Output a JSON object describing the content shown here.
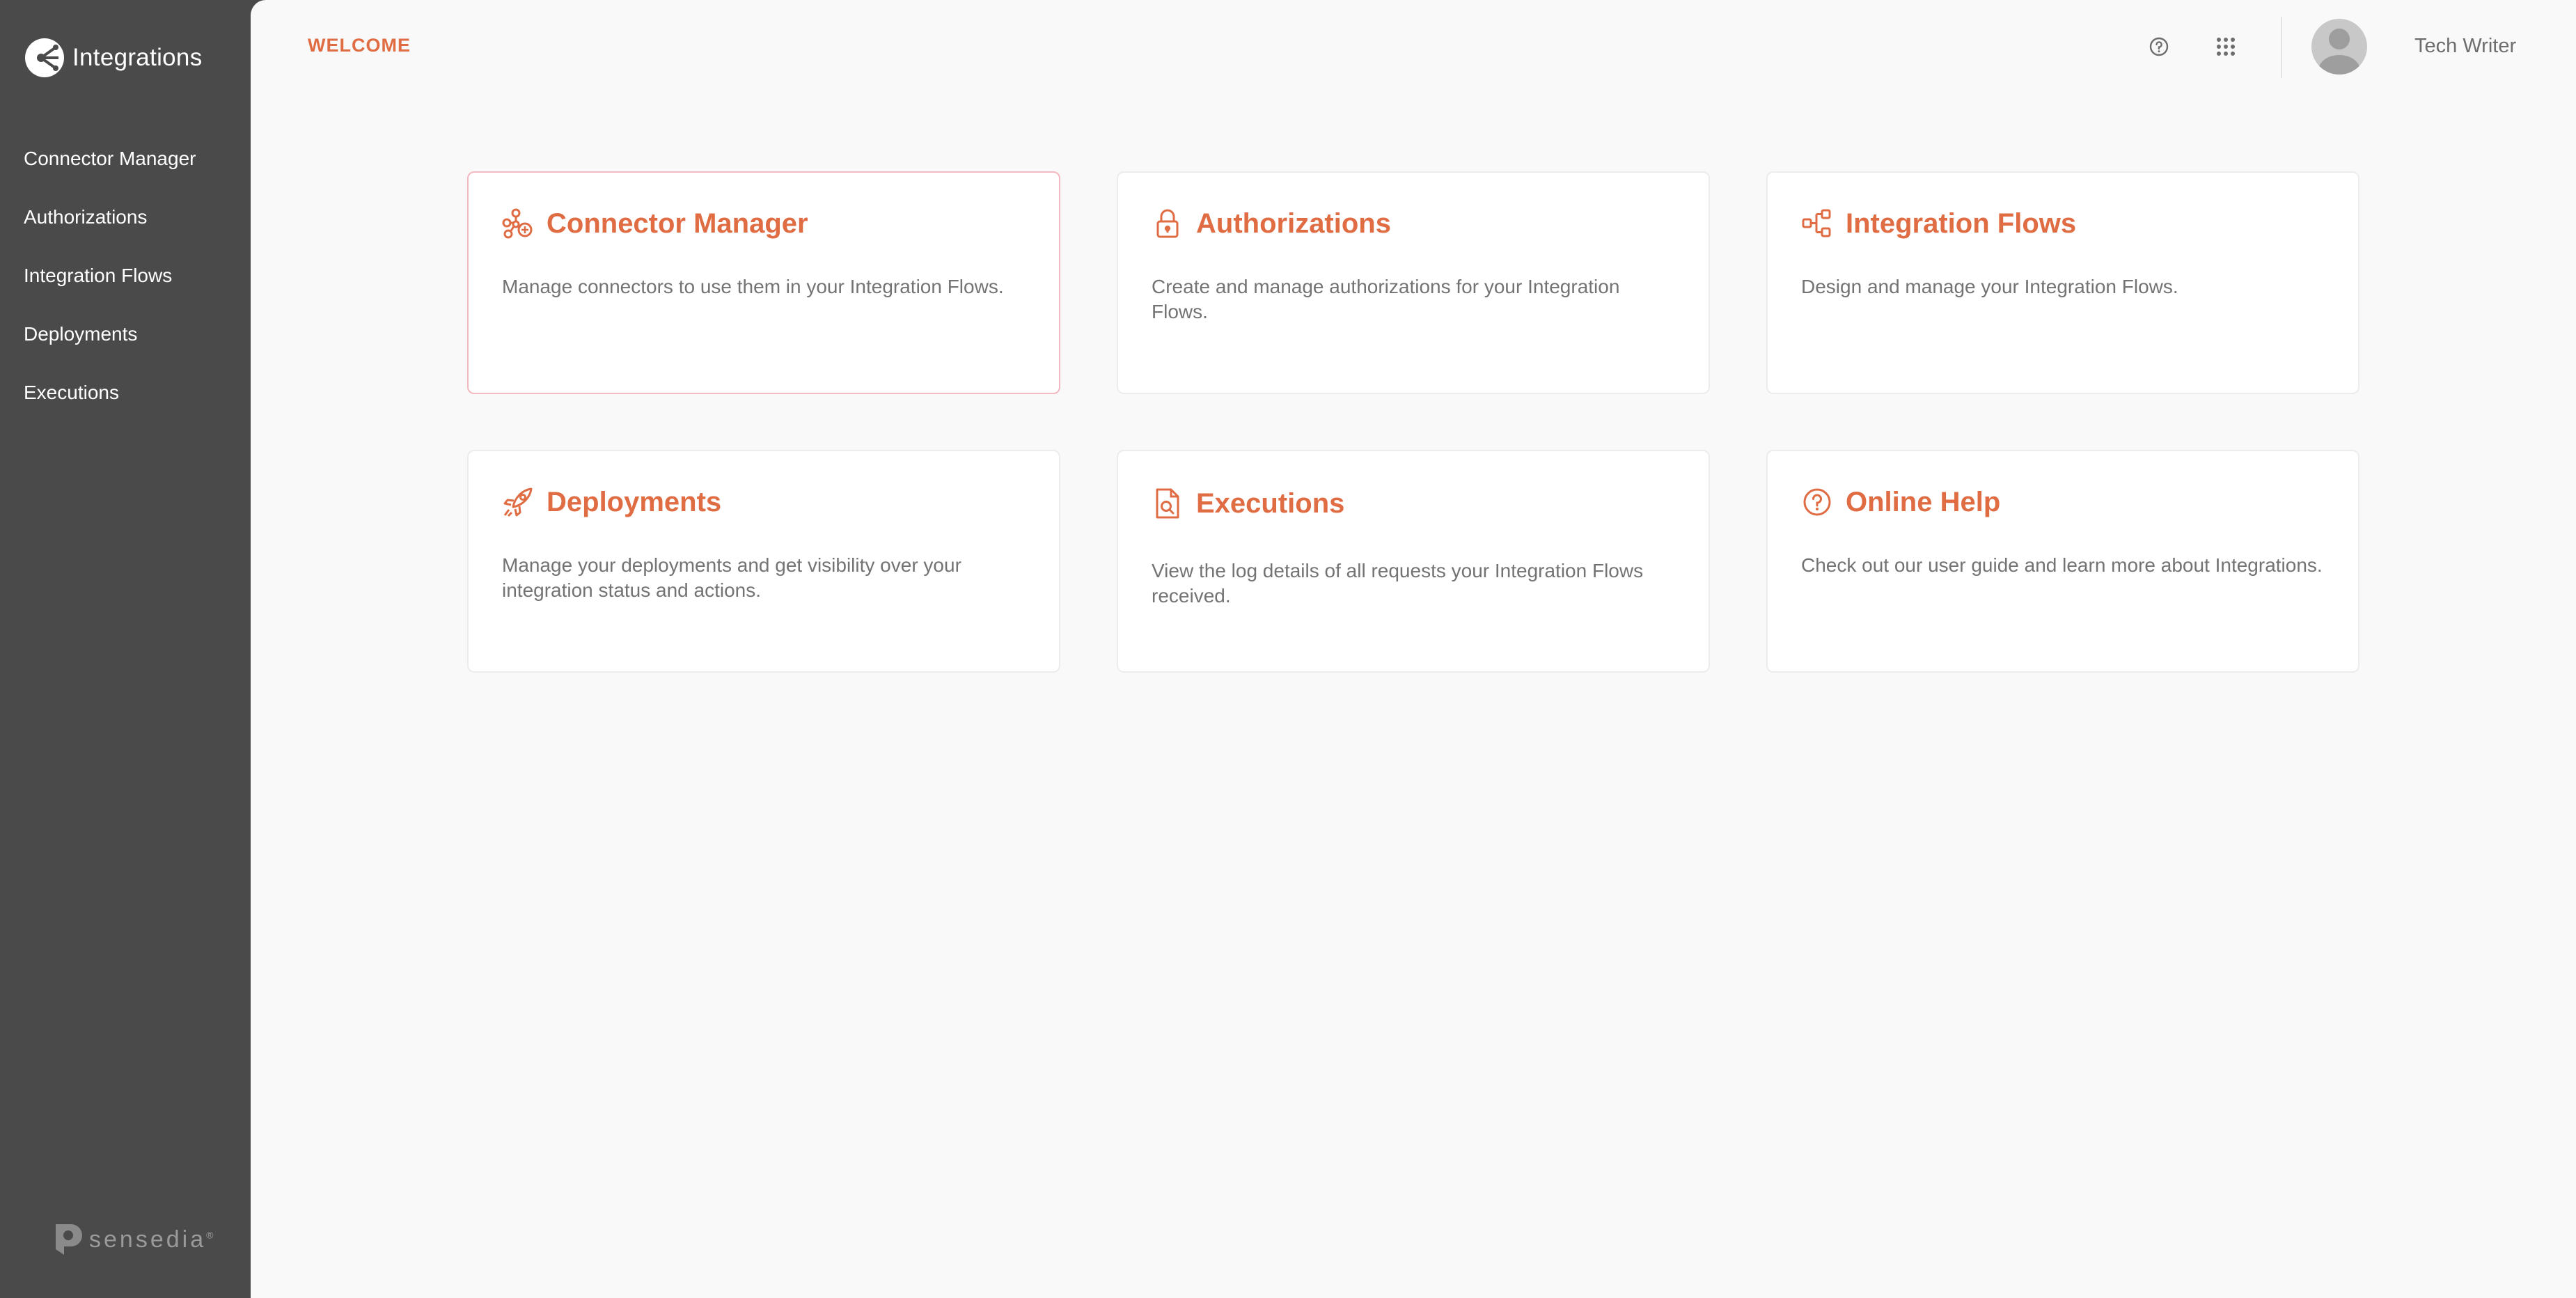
{
  "app": {
    "name": "Integrations",
    "logo_icon": "integrations-logo-icon"
  },
  "sidebar": {
    "items": [
      {
        "label": "Connector Manager"
      },
      {
        "label": "Authorizations"
      },
      {
        "label": "Integration Flows"
      },
      {
        "label": "Deployments"
      },
      {
        "label": "Executions"
      }
    ],
    "footer_brand": "sensedia",
    "footer_mark": "®"
  },
  "header": {
    "page_title": "WELCOME",
    "help_icon": "help-circle-icon",
    "apps_icon": "apps-grid-icon",
    "user_name": "Tech Writer"
  },
  "cards": [
    {
      "title": "Connector Manager",
      "description": "Manage connectors to use them in your Integration Flows.",
      "icon": "connector-hub-icon",
      "active": true
    },
    {
      "title": "Authorizations",
      "description": "Create and manage authorizations for your Integration Flows.",
      "icon": "lock-icon"
    },
    {
      "title": "Integration Flows",
      "description": "Design and manage your Integration Flows.",
      "icon": "flow-nodes-icon"
    },
    {
      "title": "Deployments",
      "description": "Manage your deployments and get visibility over your integration status and actions.",
      "icon": "rocket-icon"
    },
    {
      "title": "Executions",
      "description": "View the log details of all requests your Integration Flows received.",
      "icon": "document-search-icon"
    },
    {
      "title": "Online Help",
      "description": "Check out our user guide and learn more about Integrations.",
      "icon": "help-circle-icon"
    }
  ],
  "colors": {
    "accent": "#e06c43",
    "sidebar_bg": "#4a4a4a",
    "main_bg": "#f9f9f9",
    "active_card_border": "#f3b8c1"
  }
}
